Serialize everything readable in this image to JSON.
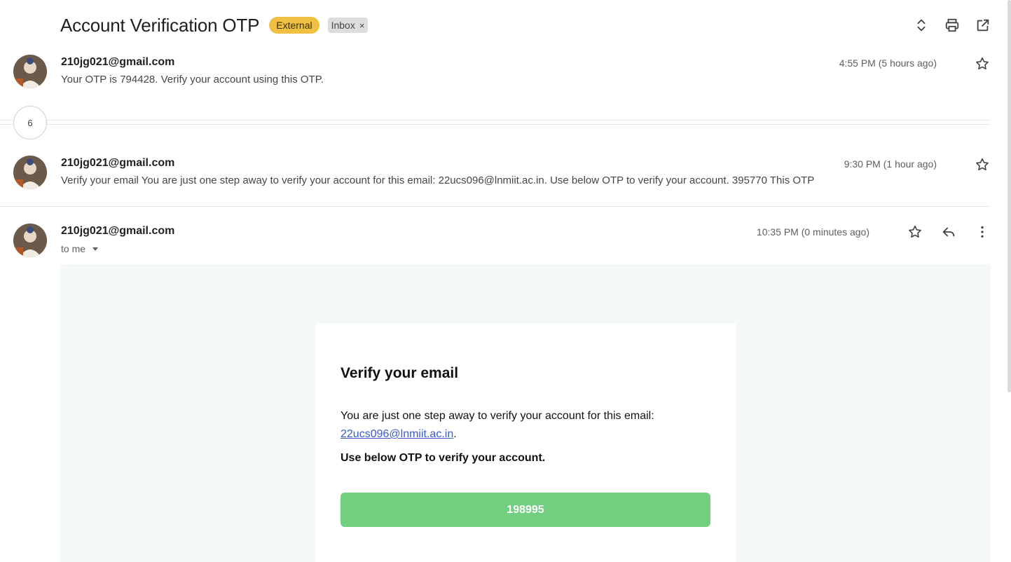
{
  "subject": {
    "title": "Account Verification OTP",
    "badge_external": "External",
    "badge_inbox": "Inbox",
    "badge_inbox_close": "×"
  },
  "top_actions": [
    "expand-collapse-icon",
    "print-icon",
    "open-new-window-icon"
  ],
  "messages": [
    {
      "sender": "210jg021@gmail.com",
      "snippet": "Your OTP is 794428. Verify your account using this OTP.",
      "time": "4:55 PM (5 hours ago)"
    },
    {
      "sender": "210jg021@gmail.com",
      "snippet": "Verify your email You are just one step away to verify your account for this email: 22ucs096@lnmiit.ac.in. Use below OTP to verify your account. 395770 This OTP",
      "time": "9:30 PM (1 hour ago)"
    },
    {
      "sender": "210jg021@gmail.com",
      "to": "to me",
      "time": "10:35 PM (0 minutes ago)"
    }
  ],
  "collapsed_count": "6",
  "email": {
    "heading": "Verify your email",
    "intro": "You are just one step away to verify your account for this email:",
    "email_link": "22ucs096@lnmiit.ac.in",
    "period": ".",
    "instruction": "Use below OTP to verify your account.",
    "otp": "198995"
  },
  "colors": {
    "external_badge": "#f0c043",
    "otp_button": "#72cf7f",
    "body_bg": "#f5f8f8",
    "link": "#3a5bc7"
  }
}
